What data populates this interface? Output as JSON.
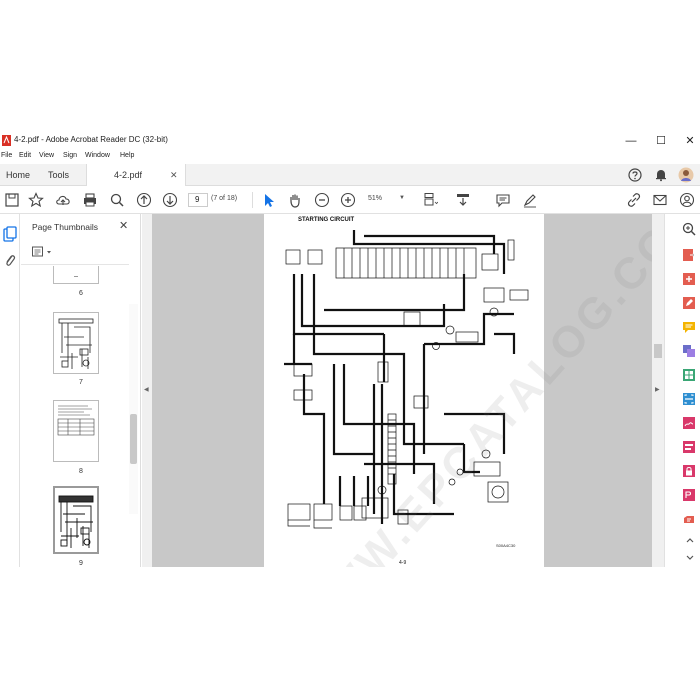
{
  "window": {
    "title": "4-2.pdf - Adobe Acrobat Reader DC (32-bit)",
    "minimize": "—",
    "maximize": "☐",
    "close": "✕"
  },
  "menu": [
    "File",
    "Edit",
    "View",
    "Sign",
    "Window",
    "Help"
  ],
  "tabs": {
    "home": "Home",
    "tools": "Tools",
    "document": "4-2.pdf",
    "document_close": "✕"
  },
  "toolbar": {
    "page_number": "9",
    "page_of": "(7 of 18)",
    "zoom": "51%",
    "zoom_caret": "▼"
  },
  "thumbnails": {
    "title": "Page Thumbnails",
    "close": "✕",
    "pages": [
      "6",
      "7",
      "8",
      "9"
    ],
    "selected": "9"
  },
  "document": {
    "heading": "STARTING CIRCUIT",
    "page_footer": "4-9",
    "figure_code": "S00A4C30",
    "watermark": "WWW.EPCATALOG.COM"
  },
  "colors": {
    "accent": "#1473e6",
    "pdf_red": "#d93025",
    "doc_bg": "#c8c8c8"
  },
  "icons": {
    "left_rail": [
      "pages-icon",
      "attachment-icon"
    ],
    "right_rail": [
      "zoom-icon",
      "export-pdf-icon",
      "create-pdf-icon",
      "edit-pdf-icon",
      "comment-icon",
      "combine-files-icon",
      "organize-pages-icon",
      "redact-icon",
      "fill-sign-icon",
      "protect-icon",
      "pdf-icon",
      "more-tools-icon"
    ]
  }
}
